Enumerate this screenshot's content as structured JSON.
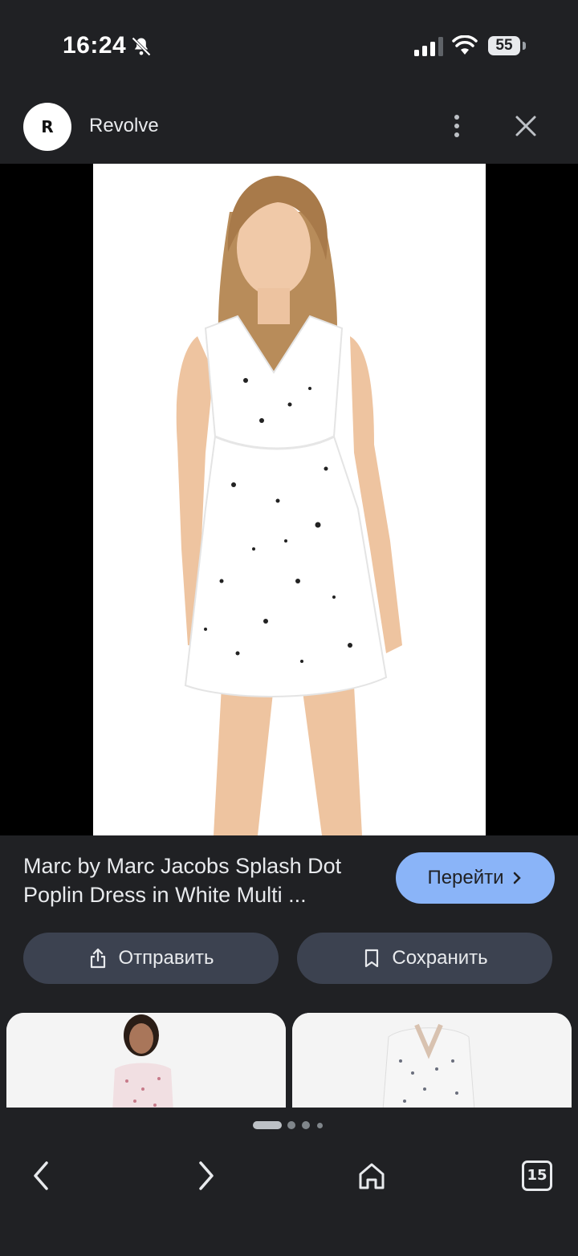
{
  "status_bar": {
    "time": "16:24",
    "battery": "55",
    "icons": [
      "bell-off-icon",
      "signal-icon",
      "wifi-icon",
      "battery-icon"
    ]
  },
  "header": {
    "avatar_letter": "R",
    "site_name": "Revolve",
    "icons": [
      "more-vertical-icon",
      "close-icon"
    ]
  },
  "product": {
    "title": "Marc by Marc Jacobs Splash Dot Poplin Dress in White Multi ...",
    "go_label": "Перейти",
    "share_label": "Отправить",
    "save_label": "Сохранить"
  },
  "pager": {
    "pages": 4,
    "active": 0
  },
  "bottom_nav": {
    "tab_count": "15",
    "icons": [
      "back-arrow-icon",
      "forward-arrow-icon",
      "home-icon",
      "tabs-icon"
    ]
  },
  "colors": {
    "background": "#202124",
    "accent": "#8ab4f8",
    "button_bg": "#3c4250"
  }
}
